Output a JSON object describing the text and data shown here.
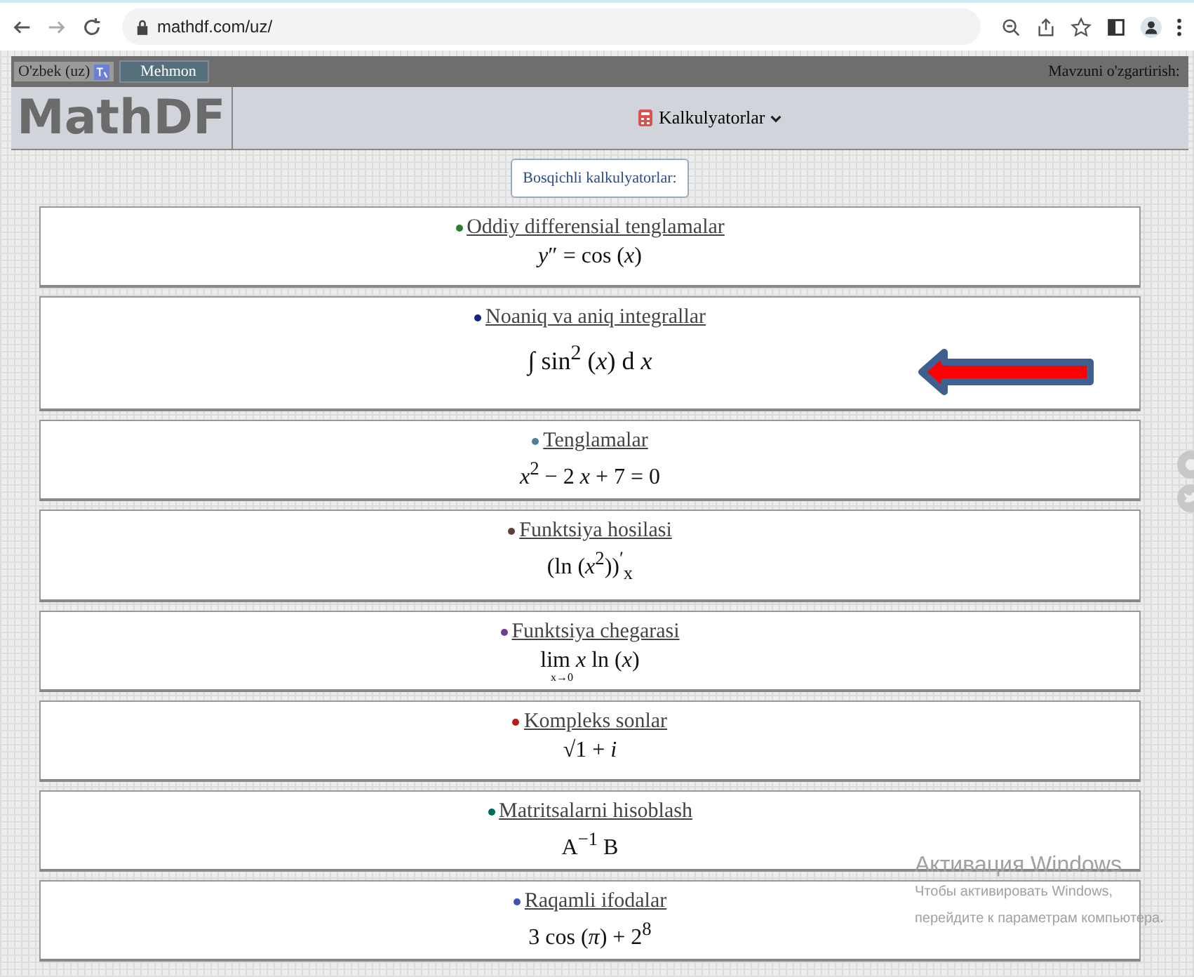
{
  "browser": {
    "url": "mathdf.com/uz/"
  },
  "top_bar": {
    "language": "O'zbek (uz)",
    "user": "Mehmon",
    "theme": "Mavzuni o'zgartirish:"
  },
  "header": {
    "logo": "MathDF",
    "menu": "Kalkulyatorlar"
  },
  "section_button": "Bosqichli kalkulyatorlar:",
  "calculators": [
    {
      "title": "Oddiy differensial tenglamalar",
      "color": "#2e7d32",
      "formula": "*y*″ = cos (*x*)"
    },
    {
      "title": "Noaniq va aniq integrallar",
      "color": "#1a237e",
      "formula": "∫ sin$^{2}$ (*x*) d *x*"
    },
    {
      "title": "Tenglamalar",
      "color": "#4f7f9f",
      "formula": "*x*$^{2}$ − 2 *x* + 7 = 0"
    },
    {
      "title": "Funktsiya hosilasi",
      "color": "#5d4037",
      "formula": "(ln (*x*$^{2}$))$^{′}$$_{x}$"
    },
    {
      "title": "Funktsiya chegarasi",
      "color": "#6a3d8f",
      "formula": "lim *x* ln (*x*)",
      "below": "x→0"
    },
    {
      "title": "Kompleks sonlar",
      "color": "#b71c1c",
      "formula": "√1 + *i*"
    },
    {
      "title": "Matritsalarni hisoblash",
      "color": "#00695c",
      "formula": "A$^{−1}$ B"
    },
    {
      "title": "Raqamli ifodalar",
      "color": "#3f51b5",
      "formula": "3 cos (*π*) + 2$^{8}$"
    }
  ],
  "os_notice": {
    "title": "Активация Windows",
    "text": "Чтобы активировать Windows, перейдите к параметрам компьютера."
  }
}
